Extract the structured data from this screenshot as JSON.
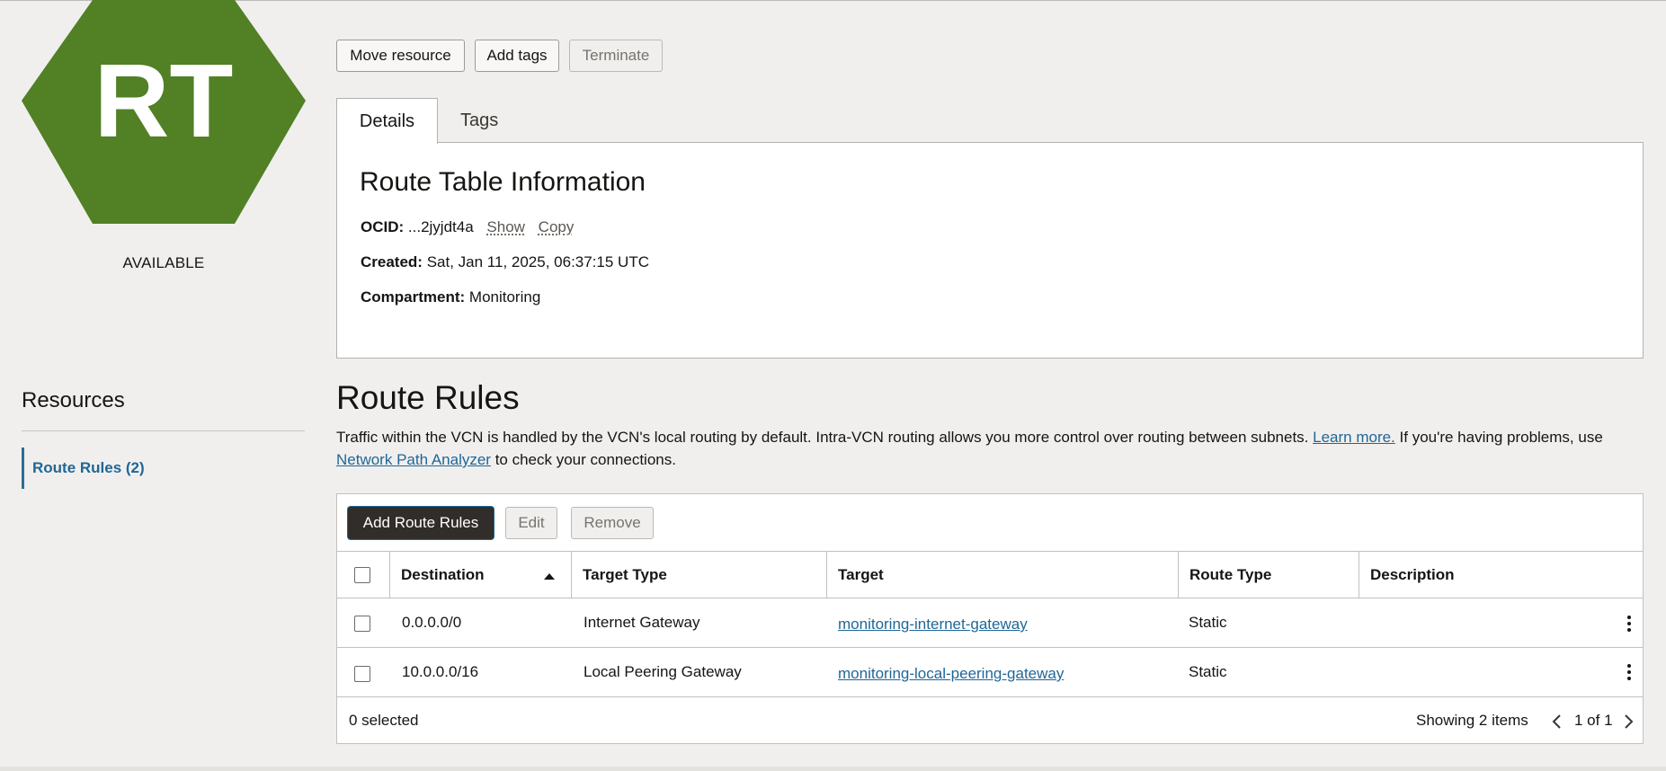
{
  "resource": {
    "initials": "RT",
    "status": "AVAILABLE",
    "hex_color": "#518025"
  },
  "actions": {
    "move_resource": "Move resource",
    "add_tags": "Add tags",
    "terminate": "Terminate"
  },
  "tabs": [
    {
      "label": "Details",
      "active": true
    },
    {
      "label": "Tags",
      "active": false
    }
  ],
  "details": {
    "title": "Route Table Information",
    "ocid_label": "OCID:",
    "ocid_value": "...2jyjdt4a",
    "show_link": "Show",
    "copy_link": "Copy",
    "created_label": "Created:",
    "created_value": "Sat, Jan 11, 2025, 06:37:15 UTC",
    "compartment_label": "Compartment:",
    "compartment_value": "Monitoring"
  },
  "resources": {
    "title": "Resources",
    "items": [
      {
        "label": "Route Rules (2)",
        "active": true
      }
    ]
  },
  "route_rules": {
    "title": "Route Rules",
    "desc_part1": "Traffic within the VCN is handled by the VCN's local routing by default. Intra-VCN routing allows you more control over routing between subnets. ",
    "learn_more": "Learn more.",
    "desc_part2": " If you're having problems, use ",
    "npa_link": "Network Path Analyzer",
    "desc_part3": " to check your connections.",
    "add_button": "Add Route Rules",
    "edit_button": "Edit",
    "remove_button": "Remove",
    "columns": [
      "Destination",
      "Target Type",
      "Target",
      "Route Type",
      "Description"
    ],
    "rows": [
      {
        "destination": "0.0.0.0/0",
        "target_type": "Internet Gateway",
        "target": "monitoring-internet-gateway",
        "route_type": "Static",
        "description": ""
      },
      {
        "destination": "10.0.0.0/16",
        "target_type": "Local Peering Gateway",
        "target": "monitoring-local-peering-gateway",
        "route_type": "Static",
        "description": ""
      }
    ],
    "selected_text": "0 selected",
    "showing_text": "Showing 2 items",
    "page_text": "1 of 1"
  },
  "colors": {
    "accent": "#1f6797",
    "primary_button": "#312d2a",
    "hex_green": "#518025"
  }
}
